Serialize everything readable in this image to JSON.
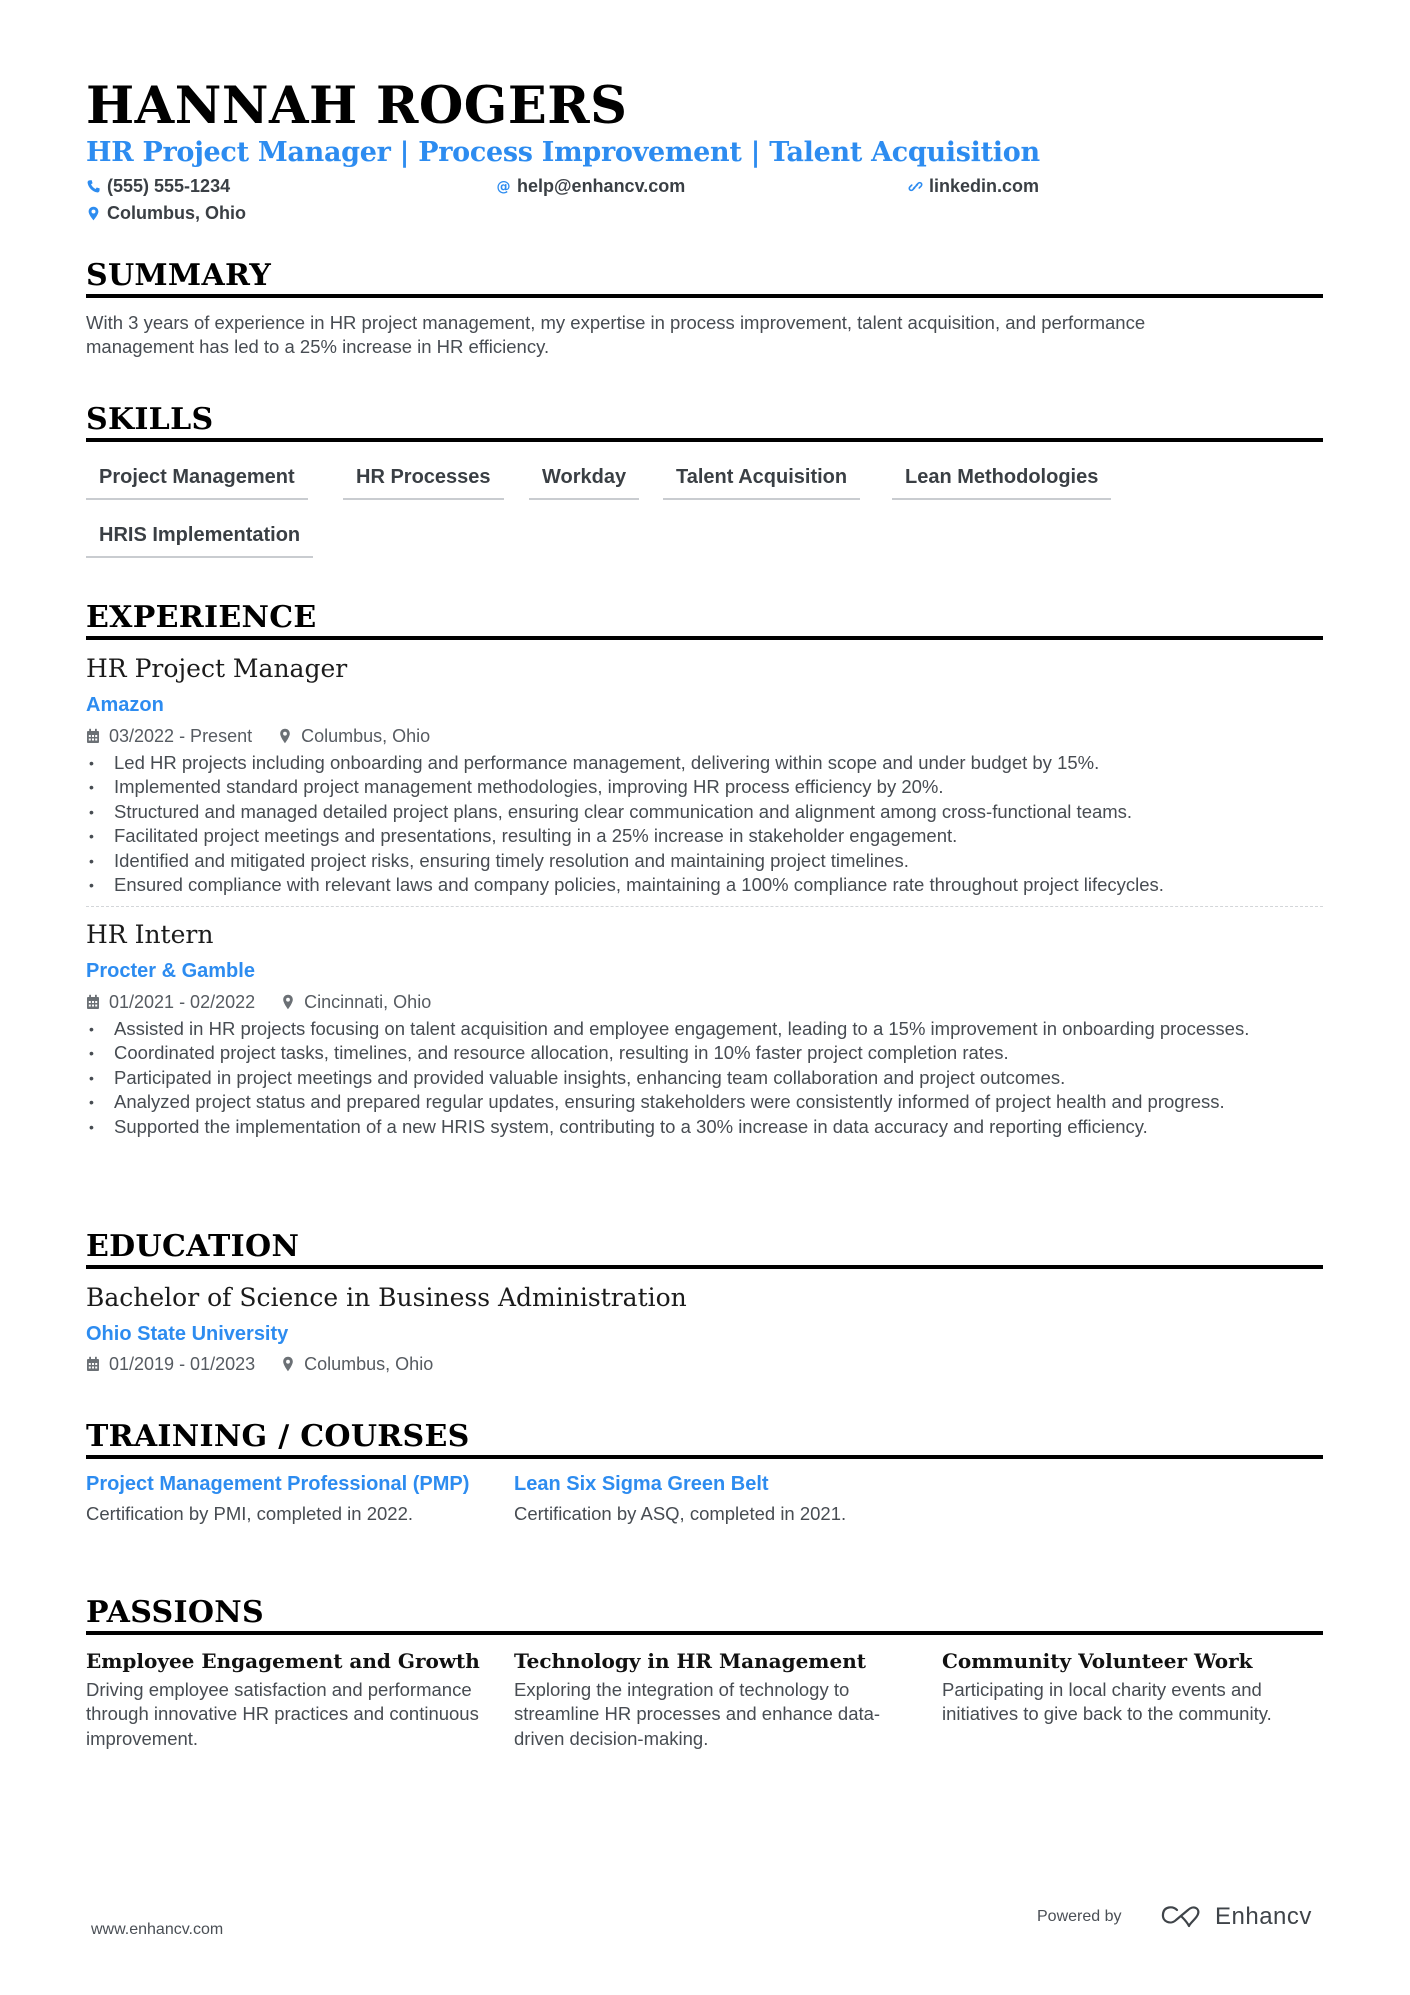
{
  "header": {
    "name": "HANNAH ROGERS",
    "headline": "HR Project Manager | Process Improvement | Talent Acquisition",
    "contacts": {
      "phone": "(555) 555-1234",
      "email": "help@enhancv.com",
      "link": "linkedin.com",
      "location": "Columbus, Ohio"
    },
    "accent_color": "#2d8cf0"
  },
  "summary": {
    "title": "SUMMARY",
    "lines": [
      "With 3 years of experience in HR project management, my expertise in process improvement, talent acquisition, and performance",
      "management has led to a 25% increase in HR efficiency."
    ]
  },
  "skills": {
    "title": "SKILLS",
    "items": [
      "Project Management",
      "HR Processes",
      "Workday",
      "Talent Acquisition",
      "Lean Methodologies",
      "HRIS Implementation"
    ]
  },
  "experience": {
    "title": "EXPERIENCE",
    "jobs": [
      {
        "role": "HR Project Manager",
        "company": "Amazon",
        "dates": "03/2022 - Present",
        "location": "Columbus, Ohio",
        "bullets": [
          "Led HR projects including onboarding and performance management, delivering within scope and under budget by 15%.",
          "Implemented standard project management methodologies, improving HR process efficiency by 20%.",
          "Structured and managed detailed project plans, ensuring clear communication and alignment among cross-functional teams.",
          "Facilitated project meetings and presentations, resulting in a 25% increase in stakeholder engagement.",
          "Identified and mitigated project risks, ensuring timely resolution and maintaining project timelines.",
          "Ensured compliance with relevant laws and company policies, maintaining a 100% compliance rate throughout project lifecycles."
        ]
      },
      {
        "role": "HR Intern",
        "company": "Procter & Gamble",
        "dates": "01/2021 - 02/2022",
        "location": "Cincinnati, Ohio",
        "bullets": [
          "Assisted in HR projects focusing on talent acquisition and employee engagement, leading to a 15% improvement in onboarding processes.",
          "Coordinated project tasks, timelines, and resource allocation, resulting in 10% faster project completion rates.",
          "Participated in project meetings and provided valuable insights, enhancing team collaboration and project outcomes.",
          "Analyzed project status and prepared regular updates, ensuring stakeholders were consistently informed of project health and progress.",
          "Supported the implementation of a new HRIS system, contributing to a 30% increase in data accuracy and reporting efficiency."
        ]
      }
    ]
  },
  "education": {
    "title": "EDUCATION",
    "items": [
      {
        "degree": "Bachelor of Science in Business Administration",
        "school": "Ohio State University",
        "dates": "01/2019 - 01/2023",
        "location": "Columbus, Ohio"
      }
    ]
  },
  "training": {
    "title": "TRAINING / COURSES",
    "items": [
      {
        "title": "Project Management Professional (PMP)",
        "description": "Certification by PMI, completed in 2022."
      },
      {
        "title": "Lean Six Sigma Green Belt",
        "description": "Certification by ASQ, completed in 2021."
      }
    ]
  },
  "passions": {
    "title": "PASSIONS",
    "items": [
      {
        "title": "Employee Engagement and Growth",
        "description": "Driving employee satisfaction and performance through innovative HR practices and continuous improvement."
      },
      {
        "title": "Technology in HR Management",
        "description": "Exploring the integration of technology to streamline HR processes and enhance data-driven decision-making."
      },
      {
        "title": "Community Volunteer Work",
        "description": "Participating in local charity events and initiatives to give back to the community."
      }
    ]
  },
  "footer": {
    "website": "www.enhancv.com",
    "powered_by": "Powered by",
    "brand": "Enhancv"
  }
}
